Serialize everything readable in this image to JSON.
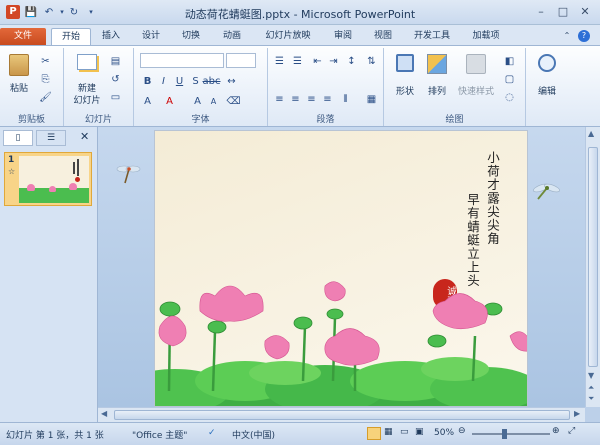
{
  "title_bar": {
    "title": "动态荷花蜻蜓图.pptx - Microsoft PowerPoint"
  },
  "tabs": [
    "文件",
    "开始",
    "插入",
    "设计",
    "切换",
    "动画",
    "幻灯片放映",
    "审阅",
    "视图",
    "开发工具",
    "加载项"
  ],
  "ribbon": {
    "paste": "粘贴",
    "new_slide_line1": "新建",
    "new_slide_line2": "幻灯片",
    "shape": "形状",
    "arrange": "排列",
    "quick_styles": "快速样式",
    "edit": "编辑",
    "groups": [
      "剪贴板",
      "幻灯片",
      "字体",
      "段落",
      "绘图"
    ]
  },
  "slide_pane": {
    "slide_number": "1",
    "star": "☆"
  },
  "slide": {
    "poem_line1": "小荷才露尖尖角",
    "poem_line2": "早有蜻蜓立上头",
    "seal": "诚斋"
  },
  "status_bar": {
    "slide_info": "幻灯片 第 1 张，共 1 张",
    "theme": "\"Office 主题\"",
    "language": "中文(中国)",
    "zoom": "50%"
  },
  "colors": {
    "file_tab": "#d45a2b",
    "ribbon_bg": "#dfe9f6",
    "slide_bg": "#f6efdc",
    "lotus_pink": "#ef7fb3",
    "leaf_green": "#37b34a",
    "seal_red": "#c8261c"
  }
}
